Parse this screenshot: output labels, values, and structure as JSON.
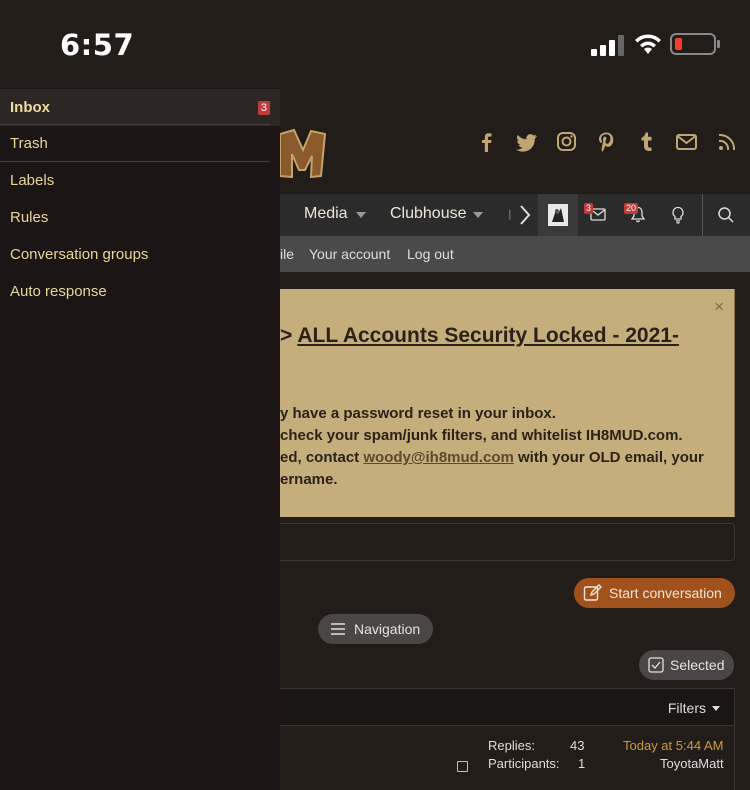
{
  "status_bar": {
    "time": "6:57"
  },
  "drawer": {
    "items": [
      {
        "label": "Inbox",
        "badge": "3",
        "active": true
      },
      {
        "label": "Trash"
      },
      {
        "label": "Labels"
      },
      {
        "label": "Rules"
      },
      {
        "label": "Conversation groups"
      },
      {
        "label": "Auto response"
      }
    ]
  },
  "navbar": {
    "items": [
      {
        "label": "Media"
      },
      {
        "label": "Clubhouse"
      }
    ],
    "conversations_badge": "3",
    "alerts_badge": "20"
  },
  "subnav": {
    "items": [
      "ile",
      "Your account",
      "Log out"
    ]
  },
  "notice": {
    "close": "×",
    "title_prefix": ">",
    "title_link": "ALL Accounts Security Locked - 2021-",
    "line1": "y have a password reset in your inbox.",
    "line2": "check your spam/junk filters, and whitelist IH8MUD.com.",
    "line3_prefix": "ed, contact",
    "line3_link": "woody@ih8mud.com",
    "line3_suffix": "with your OLD email, your",
    "line4": "ername."
  },
  "actions": {
    "start_conversation": "Start conversation",
    "navigation": "Navigation",
    "selected": "Selected",
    "filters": "Filters"
  },
  "conversation": {
    "replies_label": "Replies:",
    "replies_value": "43",
    "participants_label": "Participants:",
    "participants_value": "1",
    "date": "Today at 5:44 AM",
    "last_user": "ToyotaMatt"
  },
  "colors": {
    "accent": "#a1521c",
    "drawer_text": "#e8d59a",
    "notice_bg": "#c4af7c",
    "badge": "#c0393b"
  }
}
